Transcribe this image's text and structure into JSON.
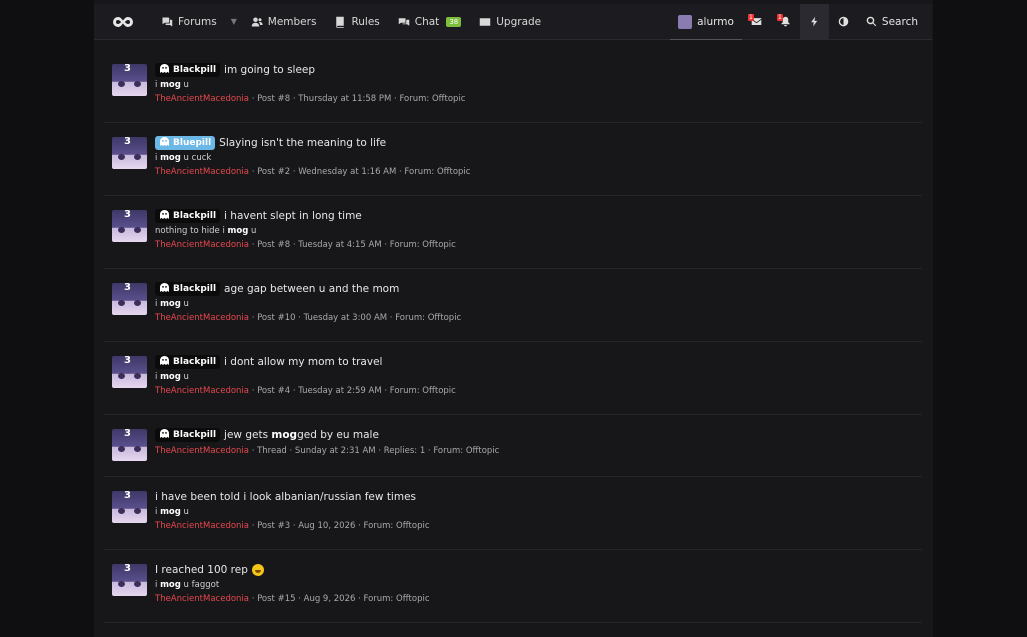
{
  "nav": {
    "forums": "Forums",
    "members": "Members",
    "rules": "Rules",
    "chat": "Chat",
    "chat_count": "38",
    "upgrade": "Upgrade",
    "username": "alurmo",
    "inbox_count": "1",
    "alerts_count": "1",
    "search": "Search"
  },
  "results": [
    {
      "badge": "Blackpill",
      "badge_type": "black",
      "title": "im going to sleep",
      "snippet_pre": "i ",
      "snippet_bold": "mog",
      "snippet_post": " u",
      "author": "TheAncientMacedonia",
      "meta": " · Post #8 · Thursday at 11:58 PM · Forum: Offtopic"
    },
    {
      "badge": "Bluepill",
      "badge_type": "blue",
      "title": "Slaying isn't the meaning to life",
      "snippet_pre": "i ",
      "snippet_bold": "mog",
      "snippet_post": " u cuck",
      "author": "TheAncientMacedonia",
      "meta": " · Post #2 · Wednesday at 1:16 AM · Forum: Offtopic"
    },
    {
      "badge": "Blackpill",
      "badge_type": "black",
      "title": "i havent slept in long time",
      "snippet_pre": "nothing to hide i ",
      "snippet_bold": "mog",
      "snippet_post": " u",
      "author": "TheAncientMacedonia",
      "meta": " · Post #8 · Tuesday at 4:15 AM · Forum: Offtopic"
    },
    {
      "badge": "Blackpill",
      "badge_type": "black",
      "title": "age gap between u and the mom",
      "snippet_pre": "i ",
      "snippet_bold": "mog",
      "snippet_post": " u",
      "author": "TheAncientMacedonia",
      "meta": " · Post #10 · Tuesday at 3:00 AM · Forum: Offtopic"
    },
    {
      "badge": "Blackpill",
      "badge_type": "black",
      "title": "i dont allow my mom to travel",
      "snippet_pre": "i ",
      "snippet_bold": "mog",
      "snippet_post": " u",
      "author": "TheAncientMacedonia",
      "meta": " · Post #4 · Tuesday at 2:59 AM · Forum: Offtopic"
    },
    {
      "badge": "Blackpill",
      "badge_type": "black",
      "title_pre": "jew gets ",
      "title_bold": "mog",
      "title_post": "ged by eu male",
      "author": "TheAncientMacedonia",
      "meta": " · Thread · Sunday at 2:31 AM · Replies: 1 · Forum: Offtopic"
    },
    {
      "title": "i have been told i look albanian/russian few times",
      "snippet_pre": "i ",
      "snippet_bold": "mog",
      "snippet_post": " u",
      "author": "TheAncientMacedonia",
      "meta": " · Post #3 · Aug 10, 2026 · Forum: Offtopic"
    },
    {
      "title": "I reached 100 rep",
      "emoji": true,
      "snippet_pre": "i ",
      "snippet_bold": "mog",
      "snippet_post": " u faggot",
      "author": "TheAncientMacedonia",
      "meta": " · Post #15 · Aug 9, 2026 · Forum: Offtopic"
    }
  ],
  "avatar_number": "3",
  "icons": [
    "logo-icon",
    "comments-icon",
    "users-icon",
    "book-icon",
    "chat-icon",
    "upgrade-icon",
    "envelope-icon",
    "bell-icon",
    "bolt-icon",
    "toggle-icon",
    "search-icon",
    "ghost-icon",
    "grin-emoji"
  ]
}
